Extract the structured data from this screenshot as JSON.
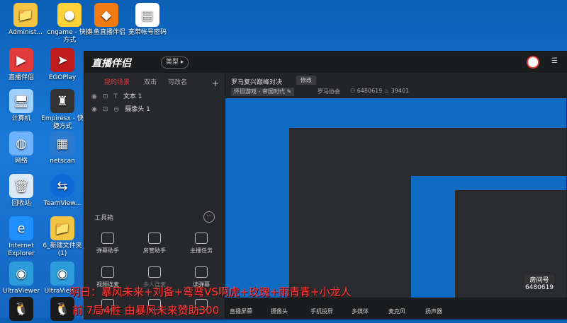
{
  "desktop": {
    "icons": [
      {
        "label": "Administ...",
        "icon": "folder-icon"
      },
      {
        "label": "cngame - 快捷方式",
        "icon": "pikachu-icon"
      },
      {
        "label": "斗鱼直播伴侣",
        "icon": "douyu-icon"
      },
      {
        "label": "宽带帐号密码",
        "icon": "document-icon"
      },
      {
        "label": "直播伴侣",
        "icon": "live-companion-icon"
      },
      {
        "label": "EGOPlay",
        "icon": "egoplay-icon"
      },
      {
        "label": "计算机",
        "icon": "computer-icon"
      },
      {
        "label": "Empiresx - 快捷方式",
        "icon": "empires-icon"
      },
      {
        "label": "网络",
        "icon": "network-icon"
      },
      {
        "label": "netscan",
        "icon": "netscan-icon"
      },
      {
        "label": "回收站",
        "icon": "recycle-bin-icon"
      },
      {
        "label": "TeamView...",
        "icon": "teamviewer-icon"
      },
      {
        "label": "Internet Explorer",
        "icon": "ie-icon"
      },
      {
        "label": "6_新建文件夹 (1)",
        "icon": "folder-icon"
      },
      {
        "label": "UltraViewer",
        "icon": "ultraviewer-icon"
      },
      {
        "label": "UltraView...",
        "icon": "ultraviewer-icon"
      },
      {
        "label": "",
        "icon": "qq-icon"
      },
      {
        "label": "",
        "icon": "qq-icon"
      }
    ]
  },
  "app": {
    "logo": "直播伴侣",
    "type_button": "类型",
    "tabs": [
      "我的场景",
      "双击",
      "可改名"
    ],
    "sources": [
      {
        "label": "文本 1",
        "icon": "text-icon"
      },
      {
        "label": "摄像头 1",
        "icon": "camera-icon"
      }
    ],
    "toolbox_title": "工具箱",
    "tools": [
      "弹幕助手",
      "房管助手",
      "主播任务",
      "视频连麦",
      "多人连麦",
      "读弹幕",
      "",
      "",
      ""
    ],
    "stream": {
      "room_title": "罗马复兴巅峰对决",
      "edit_button": "修改",
      "category": "怀旧游戏 - 帝国时代",
      "guild": "罗马协会",
      "room_id": "6480619",
      "viewers": "39401"
    },
    "bottom_buttons": [
      "直播屏幕",
      "摄像头",
      "手机投屏",
      "多媒体",
      "麦克风",
      "扬声器"
    ]
  },
  "overlay": {
    "line1": "明日：暴风未来+刘备+弯弯VS啊虎+玫瑰+雨青青+小龙人",
    "line2": "前 7局4胜  由暴风未来赞助300",
    "watermark_text": "房间号",
    "watermark_id": "6480619"
  },
  "colors": {
    "accent": "#e23b3b",
    "desktop": "#1a7ad9",
    "panel": "#27282b"
  }
}
